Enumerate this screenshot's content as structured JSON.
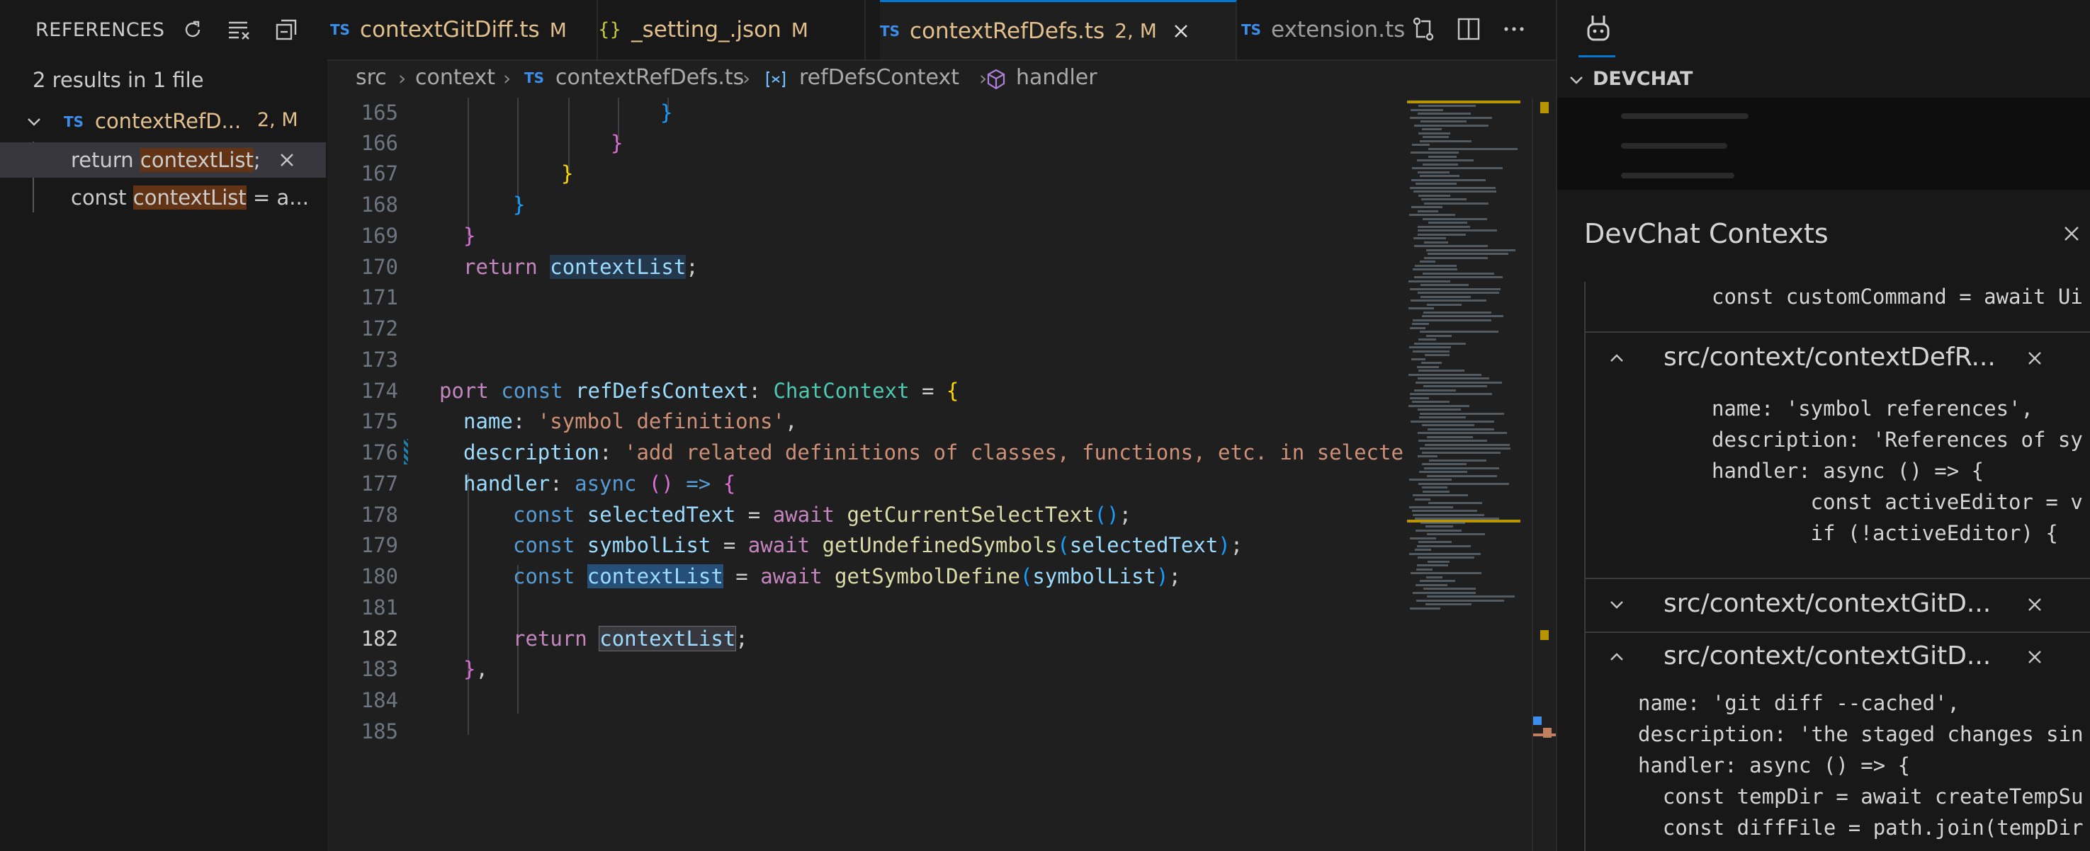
{
  "references": {
    "title": "REFERENCES",
    "summary": "2 results in 1 file",
    "file": {
      "badge": "TS",
      "name": "contextRefD...",
      "count": "2, M"
    },
    "items": [
      {
        "pre": "return ",
        "match": "contextList",
        "post": ";"
      },
      {
        "pre": "const ",
        "match": "contextList",
        "post": " = a..."
      }
    ]
  },
  "tabs": [
    {
      "badge": "TS",
      "label": "contextGitDiff.ts",
      "mark": "M"
    },
    {
      "badge": "{}",
      "label": "_setting_.json",
      "mark": "M"
    },
    {
      "badge": "TS",
      "label": "contextRefDefs.ts",
      "mark": "2, M"
    },
    {
      "badge": "TS",
      "label": "extension.ts",
      "mark": ""
    }
  ],
  "breadcrumb": {
    "src": "src",
    "context": "context",
    "file_badge": "TS",
    "file": "contextRefDefs.ts",
    "symbol": "refDefsContext",
    "method": "handler"
  },
  "editor": {
    "line_numbers": [
      "165",
      "166",
      "167",
      "168",
      "169",
      "170",
      "171",
      "172",
      "173",
      "174",
      "175",
      "176",
      "177",
      "178",
      "179",
      "180",
      "181",
      "182",
      "183",
      "184",
      "185"
    ],
    "code": {
      "l165": "}",
      "l166": "}",
      "l167": "}",
      "l168": "}",
      "l169": "}",
      "l170_kw": "return",
      "l170_var": "contextList",
      "l170_end": ";",
      "l174_a": "port",
      "l174_b": "const",
      "l174_name": "refDefsContext",
      "l174_colon": ":",
      "l174_type": "ChatContext",
      "l174_eq": " = ",
      "l174_br": "{",
      "l175_prop": "name",
      "l175_colon": ": ",
      "l175_str": "'symbol definitions'",
      "l175_end": ",",
      "l176_prop": "description",
      "l176_colon": ": ",
      "l176_str": "'add related definitions of classes, functions, etc. in selected",
      "l177_prop": "handler",
      "l177_colon": ": ",
      "l177_kw": "async",
      "l177_paren": "()",
      "l177_arrow": " => ",
      "l177_br": "{",
      "l178_kw": "const",
      "l178_var": "selectedText",
      "l178_eq": " = ",
      "l178_aw": "await",
      "l178_fn": "getCurrentSelectText",
      "l178_paren": "()",
      "l178_end": ";",
      "l179_kw": "const",
      "l179_var": "symbolList",
      "l179_eq": " = ",
      "l179_aw": "await",
      "l179_fn": "getUndefinedSymbols",
      "l179_open": "(",
      "l179_arg": "selectedText",
      "l179_close": ")",
      "l179_end": ";",
      "l180_kw": "const",
      "l180_var": "contextList",
      "l180_eq": " = ",
      "l180_aw": "await",
      "l180_fn": "getSymbolDefine",
      "l180_open": "(",
      "l180_arg": "symbolList",
      "l180_close": ")",
      "l180_end": ";",
      "l182_kw": "return",
      "l182_var": "contextList",
      "l182_end": ";",
      "l183_br": "}",
      "l183_end": ","
    }
  },
  "aux": {
    "section_title": "DEVCHAT",
    "contexts_title": "DevChat Contexts",
    "snippet_top": "const customCommand = await Ui",
    "sections": [
      {
        "path": "src/context/contextDefR...",
        "expanded": true,
        "lines": [
          "name: 'symbol references',",
          "description: 'References of sy",
          "handler: async () => {",
          "        const activeEditor = v",
          "        if (!activeEditor) {"
        ]
      },
      {
        "path": "src/context/contextGitD...",
        "expanded": false,
        "lines": []
      },
      {
        "path": "src/context/contextGitD...",
        "expanded": true,
        "lines": [
          "name: 'git diff --cached',",
          "description: 'the staged changes sin",
          "handler: async () => {",
          "  const tempDir = await createTempSu",
          "  const diffFile = path.join(tempDir"
        ]
      }
    ]
  },
  "colors": {
    "accent": "#0078d4",
    "modified": "#e2c08d",
    "match_highlight": "#623315"
  }
}
